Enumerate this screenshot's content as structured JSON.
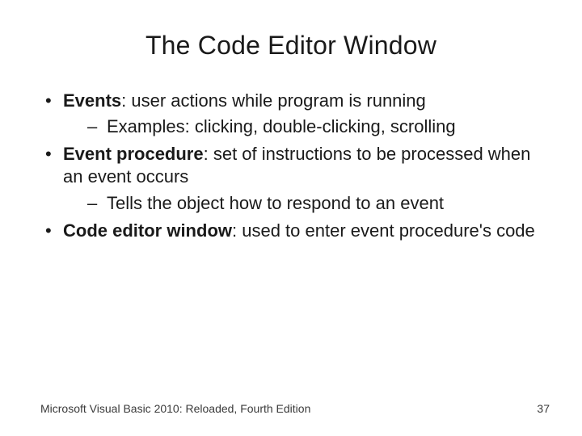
{
  "title": "The Code Editor Window",
  "bullets": [
    {
      "term": "Events",
      "rest": ": user actions while program is running",
      "sub": [
        "Examples: clicking, double-clicking, scrolling"
      ]
    },
    {
      "term": "Event procedure",
      "rest": ": set of instructions to be processed when an event occurs",
      "sub": [
        "Tells the object how to respond to an event"
      ]
    },
    {
      "term": "Code editor window",
      "rest": ": used to enter event procedure's code",
      "sub": []
    }
  ],
  "footer_left": "Microsoft Visual Basic 2010: Reloaded, Fourth Edition",
  "page_number": "37"
}
